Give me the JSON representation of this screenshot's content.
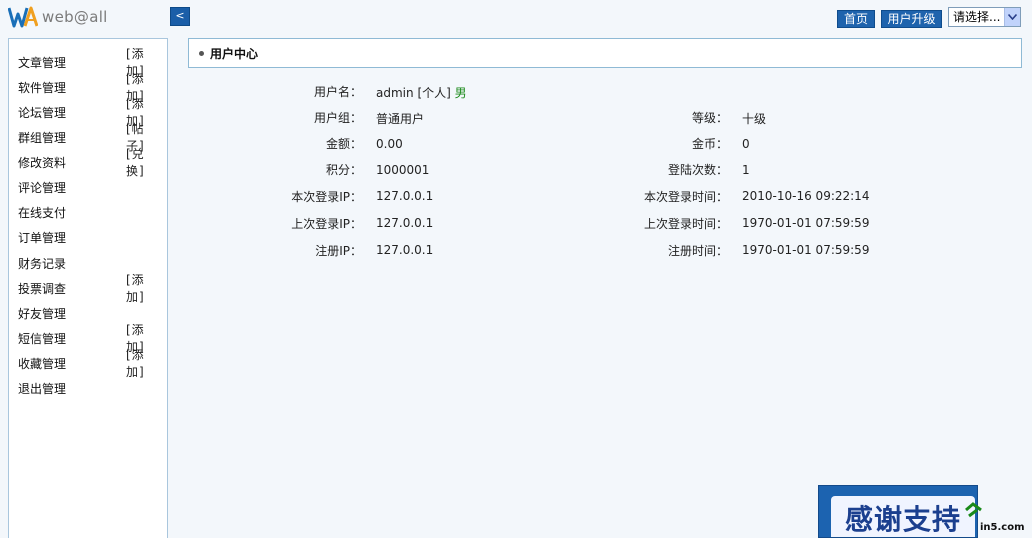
{
  "brand": {
    "logo_text": "web@all",
    "logo_icon": "wa-logo-icon"
  },
  "header": {
    "collapse_label": "<",
    "home_label": "首页",
    "upgrade_label": "用户升级",
    "select_value": "请选择...",
    "colors": {
      "button": "#1e63ad",
      "border": "#8fbad5",
      "background": "#f3f7fb"
    }
  },
  "sidebar": {
    "items": [
      {
        "label": "文章管理",
        "action": "[添加]"
      },
      {
        "label": "软件管理",
        "action": "[添加]"
      },
      {
        "label": "论坛管理",
        "action": "[添加]"
      },
      {
        "label": "群组管理",
        "action": "[帖子]"
      },
      {
        "label": "修改资料",
        "action": "[兑换]"
      },
      {
        "label": "评论管理",
        "action": ""
      },
      {
        "label": "在线支付",
        "action": ""
      },
      {
        "label": "订单管理",
        "action": ""
      },
      {
        "label": "财务记录",
        "action": ""
      },
      {
        "label": "投票调查",
        "action": "[添加]"
      },
      {
        "label": "好友管理",
        "action": ""
      },
      {
        "label": "短信管理",
        "action": "[添加]"
      },
      {
        "label": "收藏管理",
        "action": "[添加]"
      },
      {
        "label": "退出管理",
        "action": ""
      }
    ]
  },
  "panel": {
    "title": "用户中心"
  },
  "user": {
    "username_label": "用户名：",
    "username": "admin",
    "type": "[个人]",
    "gender": "男",
    "group_label": "用户组：",
    "group": "普通用户",
    "level_label": "等级：",
    "level": "十级",
    "amount_label": "金额：",
    "amount": "0.00",
    "coins_label": "金币：",
    "coins": "0",
    "points_label": "积分：",
    "points": "1000001",
    "login_count_label": "登陆次数：",
    "login_count": "1",
    "current_ip_label": "本次登录IP：",
    "current_ip": "127.0.0.1",
    "current_time_label": "本次登录时间：",
    "current_time": "2010-10-16 09:22:14",
    "last_ip_label": "上次登录IP：",
    "last_ip": "127.0.0.1",
    "last_time_label": "上次登录时间：",
    "last_time": "1970-01-01 07:59:59",
    "reg_ip_label": "注册IP：",
    "reg_ip": "127.0.0.1",
    "reg_time_label": "注册时间：",
    "reg_time": "1970-01-01 07:59:59"
  },
  "promo": {
    "text": "感谢支持",
    "watermark": "in5.com"
  }
}
